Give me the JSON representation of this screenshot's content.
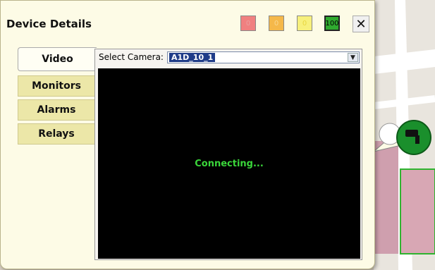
{
  "panel": {
    "title": "Device Details"
  },
  "severity": {
    "critical": "0",
    "major": "0",
    "minor": "0",
    "normal": "100"
  },
  "tabs": [
    "Video",
    "Monitors",
    "Alarms",
    "Relays"
  ],
  "camera": {
    "label": "Select Camera:",
    "selected": "A1D_10_1"
  },
  "video": {
    "status": "Connecting..."
  },
  "colors": {
    "panel_bg": "#fdfbe6",
    "tab_bg": "#ece7a8",
    "status_green": "#3ad63a",
    "selection_blue": "#1f3c88"
  },
  "icons": {
    "close": "close-icon",
    "camera_marker": "camera-marker-icon",
    "dropdown": "chevron-down-icon"
  }
}
